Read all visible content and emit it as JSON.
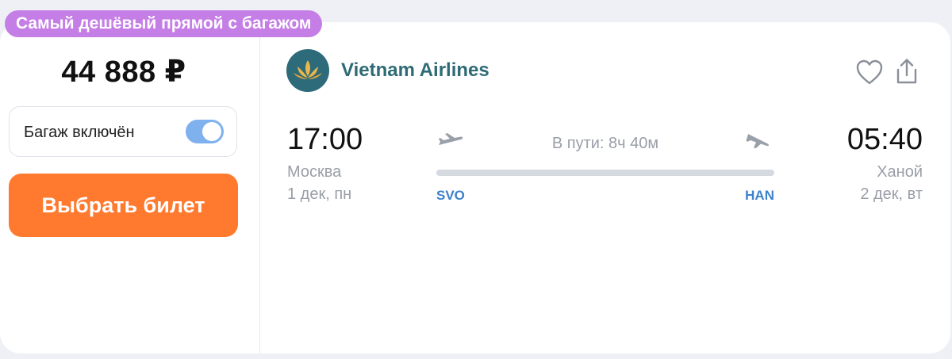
{
  "badge": {
    "label": "Самый дешёвый прямой с багажом"
  },
  "offer": {
    "price": "44 888 ₽",
    "baggage_label": "Багаж включён",
    "baggage_included": true,
    "buy_label": "Выбрать билет"
  },
  "airline": {
    "name": "Vietnam Airlines",
    "logo_icon": "lotus-logo"
  },
  "actions": {
    "favorite_icon": "heart-icon",
    "share_icon": "share-icon"
  },
  "flight": {
    "departure": {
      "time": "17:00",
      "city": "Москва",
      "date": "1 дек, пн",
      "code": "SVO"
    },
    "arrival": {
      "time": "05:40",
      "city": "Ханой",
      "date": "2 дек, вт",
      "code": "HAN"
    },
    "duration": "В пути: 8ч 40м"
  },
  "colors": {
    "badge": "#c57ee6",
    "button": "#ff7a2f",
    "toggle": "#7fb1ee",
    "airline": "#2e6b74",
    "airport_code": "#3c82cc"
  }
}
